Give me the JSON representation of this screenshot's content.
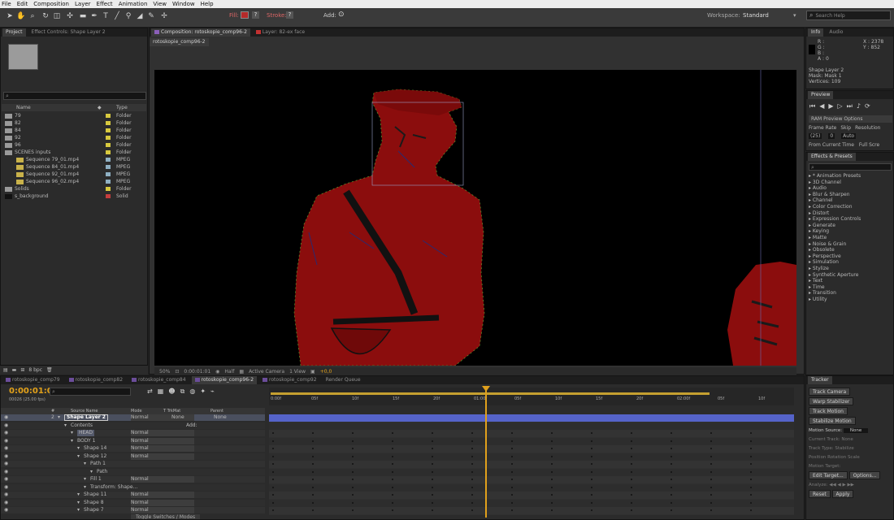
{
  "menu": [
    "File",
    "Edit",
    "Composition",
    "Layer",
    "Effect",
    "Animation",
    "View",
    "Window",
    "Help"
  ],
  "toolbar": {
    "fill_label": "Fill:",
    "stroke_label": "Stroke:",
    "add_label": "Add:",
    "workspace_label": "Workspace:",
    "workspace_value": "Standard",
    "search_placeholder": "Search Help"
  },
  "project_panel": {
    "tabs": [
      "Project",
      "Effect Controls: Shape Layer 2"
    ],
    "columns": {
      "name": "Name",
      "type": "Type"
    },
    "items": [
      {
        "name": "79",
        "type": "Folder",
        "color": "#d7c93f",
        "icon": "folder-icon",
        "indent": 0
      },
      {
        "name": "82",
        "type": "Folder",
        "color": "#d7c93f",
        "icon": "folder-icon",
        "indent": 0
      },
      {
        "name": "84",
        "type": "Folder",
        "color": "#d7c93f",
        "icon": "folder-icon",
        "indent": 0
      },
      {
        "name": "92",
        "type": "Folder",
        "color": "#d7c93f",
        "icon": "folder-icon",
        "indent": 0
      },
      {
        "name": "96",
        "type": "Folder",
        "color": "#d7c93f",
        "icon": "folder-icon",
        "indent": 0
      },
      {
        "name": "SCENES inputs",
        "type": "Folder",
        "color": "#d7c93f",
        "icon": "folder-icon",
        "indent": 0
      },
      {
        "name": "Sequence 79_01.mp4",
        "type": "MPEG",
        "color": "#8fb0c3",
        "icon": "footage-icon",
        "indent": 1
      },
      {
        "name": "Sequence 84_01.mp4",
        "type": "MPEG",
        "color": "#8fb0c3",
        "icon": "footage-icon",
        "indent": 1
      },
      {
        "name": "Sequence 92_01.mp4",
        "type": "MPEG",
        "color": "#8fb0c3",
        "icon": "footage-icon",
        "indent": 1
      },
      {
        "name": "Sequence 96_02.mp4",
        "type": "MPEG",
        "color": "#8fb0c3",
        "icon": "footage-icon",
        "indent": 1
      },
      {
        "name": "Solids",
        "type": "Folder",
        "color": "#d7c93f",
        "icon": "folder-icon",
        "indent": 0
      },
      {
        "name": "s_background",
        "type": "Solid",
        "color": "#c43d3d",
        "icon": "solid-icon",
        "indent": 0
      }
    ],
    "bit_depth": "8 bpc"
  },
  "composition": {
    "tabs": [
      "Composition: rotoskopie_comp96-2",
      "Layer: 82-ex face"
    ],
    "breadcrumb": "rotoskopie_comp96-2",
    "zoom": "50%",
    "timecode": "0:00:01:01",
    "resolution": "Half",
    "camera": "Active Camera",
    "views": "1 View",
    "exposure": "+0,0"
  },
  "info_panel": {
    "tabs": [
      "Info",
      "Audio"
    ],
    "r": "R :",
    "g": "G :",
    "b": "B :",
    "a": "A : 0",
    "x": "X : 2378",
    "y": "Y : 852",
    "layer": "Shape Layer 2",
    "mask": "Mask: Mask 1",
    "vertices": "Vertices: 109"
  },
  "preview_panel": {
    "title": "Preview",
    "ram_options": "RAM Preview Options",
    "frame_rate_label": "Frame Rate",
    "skip_label": "Skip",
    "resolution_label": "Resolution",
    "frame_rate": "(25)",
    "skip": "0",
    "resolution": "Auto",
    "from_current": "From Current Time",
    "full_screen": "Full Scre"
  },
  "effects_panel": {
    "title": "Effects & Presets",
    "items": [
      "* Animation Presets",
      "3D Channel",
      "Audio",
      "Blur & Sharpen",
      "Channel",
      "Color Correction",
      "Distort",
      "Expression Controls",
      "Generate",
      "Keying",
      "Matte",
      "Noise & Grain",
      "Obsolete",
      "Perspective",
      "Simulation",
      "Stylize",
      "Synthetic Aperture",
      "Text",
      "Time",
      "Transition",
      "Utility"
    ]
  },
  "timeline": {
    "tabs": [
      {
        "label": "rotoskopie_comp79",
        "color": "#6b4d9a"
      },
      {
        "label": "rotoskopie_comp82",
        "color": "#6b4d9a"
      },
      {
        "label": "rotoskopie_comp84",
        "color": "#6b4d9a"
      },
      {
        "label": "rotoskopie_comp96-2",
        "color": "#6b4d9a"
      },
      {
        "label": "rotoskopie_comp92",
        "color": "#6b4d9a"
      },
      {
        "label": "Render Queue",
        "color": ""
      }
    ],
    "timecode": "0:00:01:01",
    "timecode_sub": "00026 (25.00 fps)",
    "columns": {
      "num": "#",
      "source": "Source Name",
      "mode": "Mode",
      "trkmat": "T  TrkMat",
      "parent": "Parent"
    },
    "ruler": [
      "0:00f",
      "05f",
      "10f",
      "15f",
      "20f",
      "01:00f",
      "05f",
      "10f",
      "15f",
      "20f",
      "02:00f",
      "05f",
      "10f"
    ],
    "layers": [
      {
        "num": "2",
        "name": "Shape Layer 2",
        "mode": "Normal",
        "trkmat": "None",
        "parent": "None",
        "indent": 0,
        "selected": true
      },
      {
        "name": "Contents",
        "add": "Add:",
        "indent": 1
      },
      {
        "name": "HEAD",
        "mode": "Normal",
        "indent": 2,
        "highlight": true
      },
      {
        "name": "BODY 1",
        "mode": "Normal",
        "indent": 2
      },
      {
        "name": "Shape 14",
        "mode": "Normal",
        "indent": 3
      },
      {
        "name": "Shape 12",
        "mode": "Normal",
        "indent": 3
      },
      {
        "name": "Path 1",
        "indent": 4
      },
      {
        "name": "Path",
        "indent": 5
      },
      {
        "name": "Fill 1",
        "mode": "Normal",
        "indent": 4
      },
      {
        "name": "Transform: Shape...",
        "indent": 4
      },
      {
        "name": "Shape 11",
        "mode": "Normal",
        "indent": 3
      },
      {
        "name": "Shape 8",
        "mode": "Normal",
        "indent": 3
      },
      {
        "name": "Shape 7",
        "mode": "Normal",
        "indent": 3
      }
    ],
    "toggle_label": "Toggle Switches / Modes"
  },
  "tracker_panel": {
    "title": "Tracker",
    "track_camera": "Track Camera",
    "warp_stabilizer": "Warp Stabilizer",
    "track_motion": "Track Motion",
    "stabilize_motion": "Stabilize Motion",
    "motion_source_label": "Motion Source:",
    "motion_source": "None",
    "current_track_label": "Current Track:",
    "current_track": "None",
    "track_type_label": "Track Type:",
    "track_type": "Stabilize",
    "position": "Position",
    "rotation": "Rotation",
    "scale": "Scale",
    "motion_target": "Motion Target:",
    "edit_target": "Edit Target...",
    "options": "Options...",
    "analyze": "Analyze:",
    "reset": "Reset",
    "apply": "Apply"
  },
  "colors": {
    "accent_red": "#8b0d0d",
    "timecode_orange": "#e3a21a",
    "layer_bar": "#5563c9",
    "playhead": "#e0a01c"
  }
}
